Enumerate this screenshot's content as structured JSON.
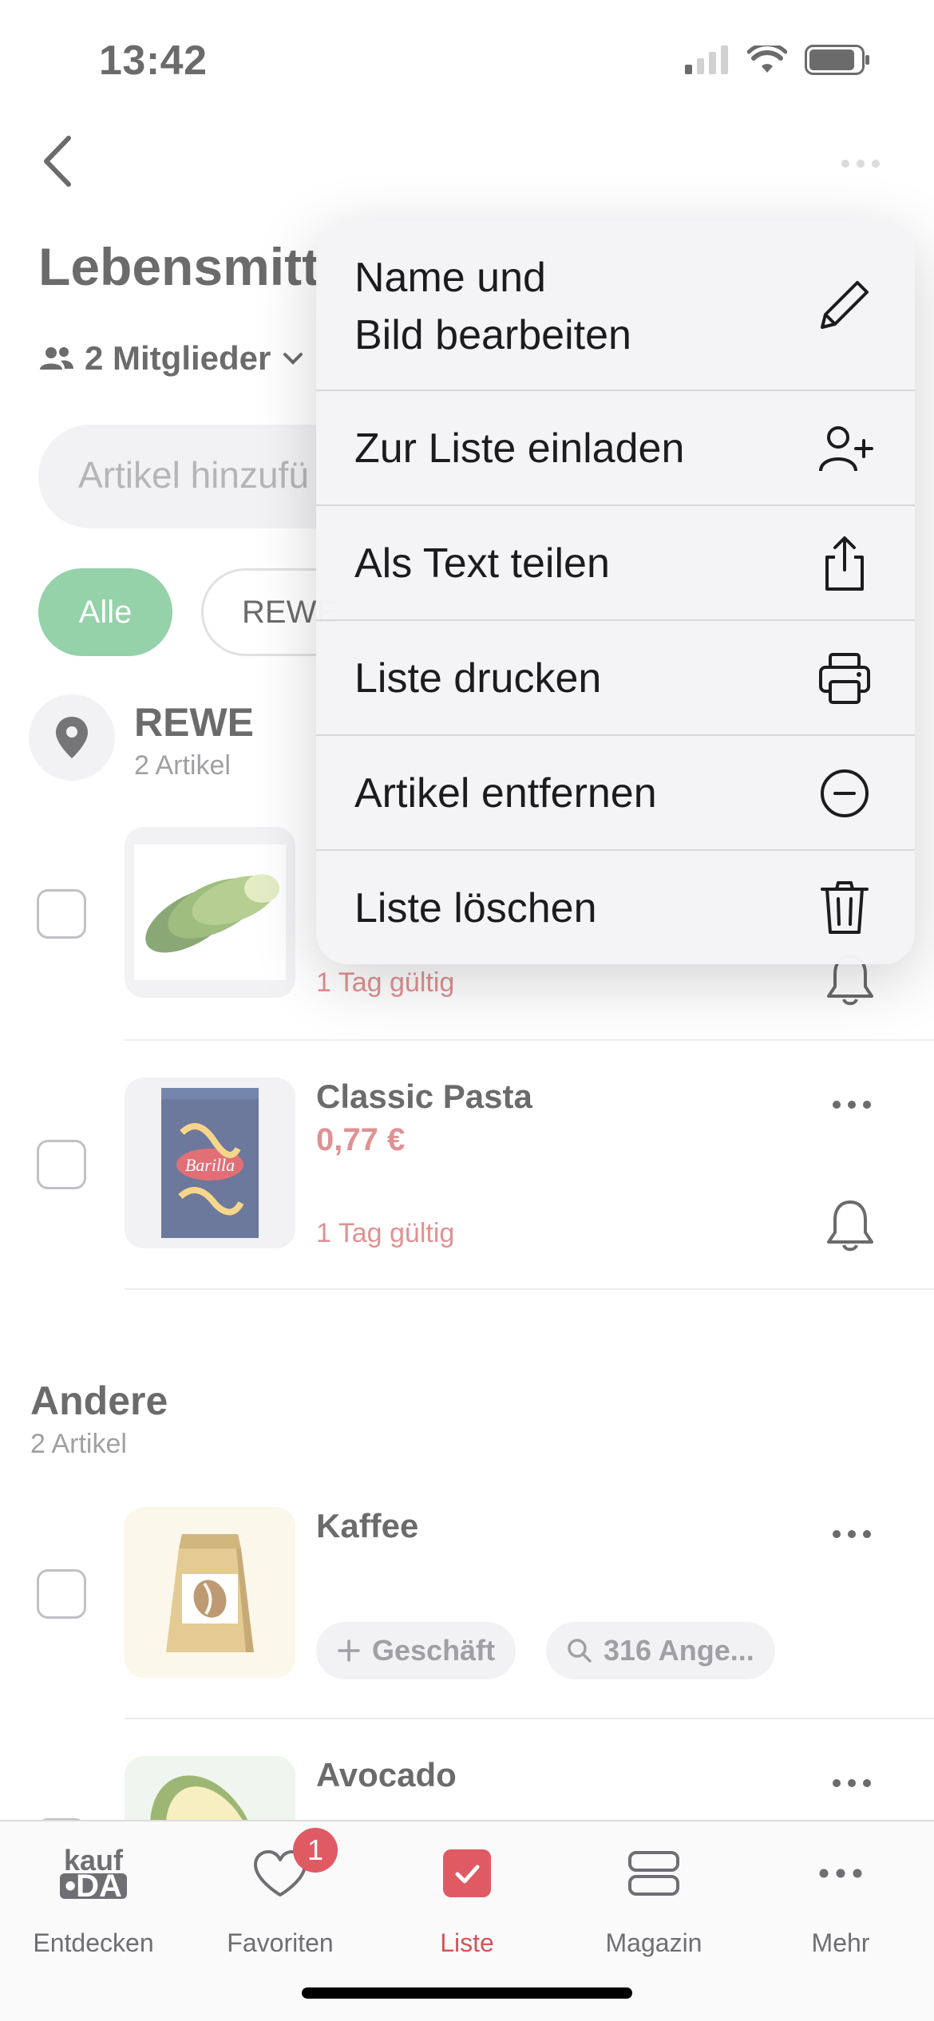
{
  "status": {
    "time": "13:42"
  },
  "header": {
    "title": "Lebensmitt",
    "members_label": "2 Mitglieder",
    "search_placeholder": "Artikel hinzufü"
  },
  "filters": {
    "all": "Alle",
    "rewe": "REWE"
  },
  "store": {
    "name": "REWE",
    "count": "2 Artikel"
  },
  "items_rewe": [
    {
      "title": "",
      "price": "",
      "valid": "1 Tag gültig",
      "icon": "lettuce-image"
    },
    {
      "title": "Classic Pasta",
      "price": "0,77 €",
      "valid": "1 Tag gültig",
      "icon": "pasta-image"
    }
  ],
  "section_other": {
    "title": "Andere",
    "count": "2 Artikel"
  },
  "items_other": [
    {
      "title": "Kaffee",
      "pill_store": "Geschäft",
      "pill_offers": "316 Ange...",
      "icon": "coffee-bag-image"
    },
    {
      "title": "Avocado",
      "icon": "avocado-image"
    }
  ],
  "menu": {
    "items": [
      {
        "label_line1": "Name und",
        "label_line2": "Bild bearbeiten",
        "icon": "pencil-icon"
      },
      {
        "label": "Zur Liste einladen",
        "icon": "add-person-icon"
      },
      {
        "label": "Als Text teilen",
        "icon": "share-icon"
      },
      {
        "label": "Liste drucken",
        "icon": "printer-icon"
      },
      {
        "label": "Artikel entfernen",
        "icon": "minus-circle-icon"
      },
      {
        "label": "Liste löschen",
        "icon": "trash-icon"
      }
    ]
  },
  "tabbar": {
    "tabs": [
      {
        "label": "Entdecken",
        "logo_top": "kauf",
        "logo_bottom": "•DA",
        "icon": "kaufda-logo"
      },
      {
        "label": "Favoriten",
        "badge": "1",
        "icon": "heart-icon"
      },
      {
        "label": "Liste",
        "icon": "checklist-icon"
      },
      {
        "label": "Magazin",
        "icon": "magazine-icon"
      },
      {
        "label": "Mehr",
        "icon": "more-icon"
      }
    ]
  },
  "colors": {
    "accent_green": "#5cb87c",
    "price_red": "#d0565a",
    "badge_red": "#e05a64"
  }
}
